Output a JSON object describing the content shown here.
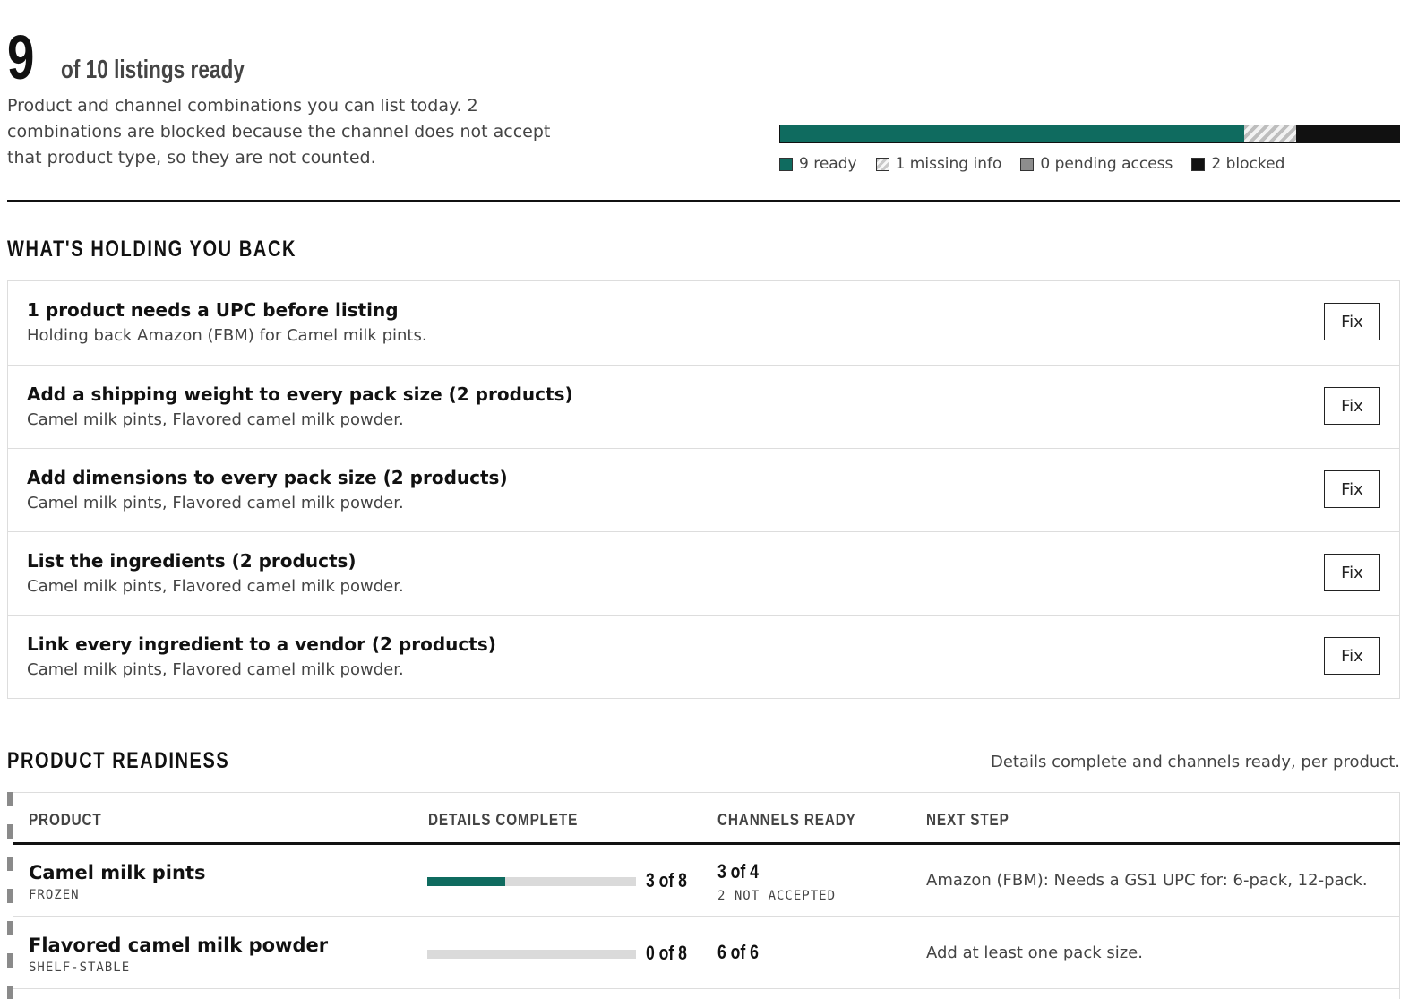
{
  "summary": {
    "ready_number": "9",
    "headline_suffix": "of 10 listings ready",
    "description": "Product and channel combinations you can list today. 2 combinations are blocked because the channel does not accept that product type, so they are not counted.",
    "progress": {
      "ready": 9,
      "missing_info": 1,
      "pending_access": 0,
      "blocked": 2,
      "total": 12
    },
    "legend": {
      "ready": "9 ready",
      "missing": "1 missing info",
      "pending": "0 pending access",
      "blocked": "2 blocked"
    },
    "colors": {
      "ready": "#0f6b5f",
      "pending": "#8d8d8d",
      "blocked": "#111111"
    }
  },
  "blockers": {
    "heading": "WHAT'S HOLDING YOU BACK",
    "items": [
      {
        "title": "1 product needs a UPC before listing",
        "description": "Holding back Amazon (FBM) for Camel milk pints.",
        "action": "Fix"
      },
      {
        "title": "Add a shipping weight to every pack size (2 products)",
        "description": "Camel milk pints, Flavored camel milk powder.",
        "action": "Fix"
      },
      {
        "title": "Add dimensions to every pack size (2 products)",
        "description": "Camel milk pints, Flavored camel milk powder.",
        "action": "Fix"
      },
      {
        "title": "List the ingredients (2 products)",
        "description": "Camel milk pints, Flavored camel milk powder.",
        "action": "Fix"
      },
      {
        "title": "Link every ingredient to a vendor (2 products)",
        "description": "Camel milk pints, Flavored camel milk powder.",
        "action": "Fix"
      }
    ]
  },
  "readiness": {
    "heading": "PRODUCT READINESS",
    "caption": "Details complete and channels ready, per product.",
    "columns": {
      "product": "PRODUCT",
      "details": "DETAILS COMPLETE",
      "channels": "CHANNELS READY",
      "next": "NEXT STEP"
    },
    "rows": [
      {
        "name": "Camel milk pints",
        "storage": "FROZEN",
        "details_done": 3,
        "details_total": 8,
        "details_label": "3 of 8",
        "channels_label": "3 of 4",
        "channels_note": "2 NOT ACCEPTED",
        "next_step": "Amazon (FBM): Needs a GS1 UPC for: 6-pack, 12-pack."
      },
      {
        "name": "Flavored camel milk powder",
        "storage": "SHELF-STABLE",
        "details_done": 0,
        "details_total": 8,
        "details_label": "0 of 8",
        "channels_label": "6 of 6",
        "channels_note": "",
        "next_step": "Add at least one pack size."
      }
    ]
  }
}
